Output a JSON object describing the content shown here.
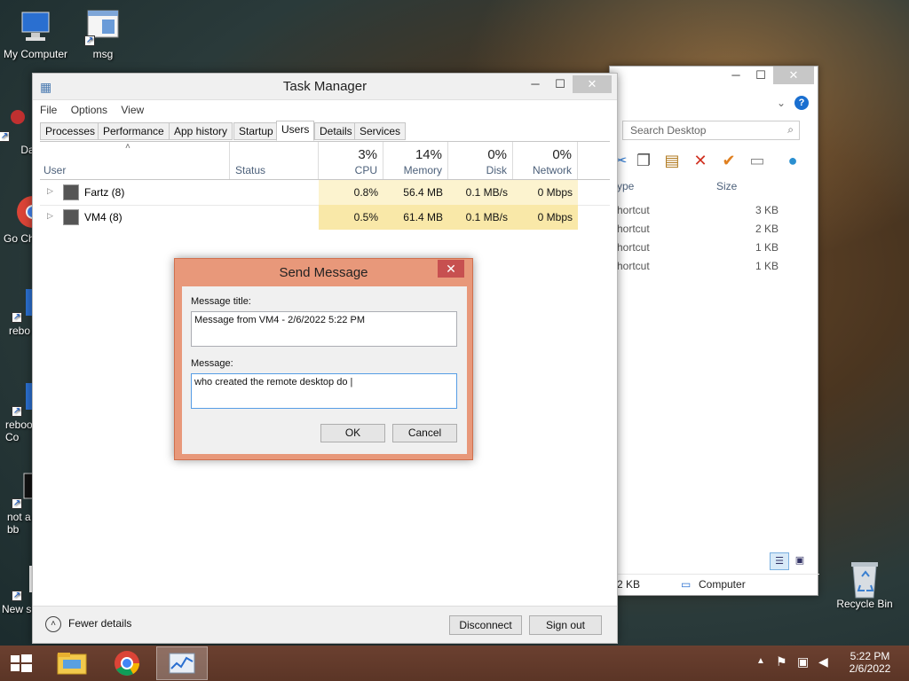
{
  "desktop": {
    "icons": [
      {
        "label": "My Computer"
      },
      {
        "label": "msg"
      },
      {
        "label": "DataW"
      },
      {
        "label": "Go Chr"
      },
      {
        "label": "rebo"
      },
      {
        "label": "reboo Co"
      },
      {
        "label": "not a bb"
      },
      {
        "label": "New s"
      },
      {
        "label": "Recycle Bin"
      }
    ]
  },
  "explorer": {
    "search_placeholder": "Search Desktop",
    "columns": {
      "type": "ype",
      "size": "Size"
    },
    "rows": [
      {
        "type": "hortcut",
        "size": "3 KB"
      },
      {
        "type": "hortcut",
        "size": "2 KB"
      },
      {
        "type": "hortcut",
        "size": "1 KB"
      },
      {
        "type": "hortcut",
        "size": "1 KB"
      }
    ],
    "status_size": "2 KB",
    "status_location": "Computer"
  },
  "taskmgr": {
    "title": "Task Manager",
    "menu": {
      "file": "File",
      "options": "Options",
      "view": "View"
    },
    "tabs": [
      "Processes",
      "Performance",
      "App history",
      "Startup",
      "Users",
      "Details",
      "Services"
    ],
    "active_tab": "Users",
    "columns": {
      "user": "User",
      "status": "Status",
      "cpu_pct": "3%",
      "cpu": "CPU",
      "mem_pct": "14%",
      "mem": "Memory",
      "disk_pct": "0%",
      "disk": "Disk",
      "net_pct": "0%",
      "net": "Network"
    },
    "users": [
      {
        "name": "Fartz (8)",
        "status": "",
        "cpu": "0.8%",
        "mem": "56.4 MB",
        "disk": "0.1 MB/s",
        "net": "0 Mbps"
      },
      {
        "name": "VM4 (8)",
        "status": "",
        "cpu": "0.5%",
        "mem": "61.4 MB",
        "disk": "0.1 MB/s",
        "net": "0 Mbps"
      }
    ],
    "fewer_details": "Fewer details",
    "disconnect": "Disconnect",
    "sign_out": "Sign out"
  },
  "dialog": {
    "title": "Send Message",
    "title_label": "Message title:",
    "title_value": "Message from VM4 - 2/6/2022 5:22 PM",
    "message_label": "Message:",
    "message_value": "who created the remote desktop do |",
    "ok": "OK",
    "cancel": "Cancel"
  },
  "taskbar": {
    "time": "5:22 PM",
    "date": "2/6/2022"
  },
  "colors": {
    "dialog_frame": "#e8987a",
    "taskbar": "#5b3526",
    "cpu_heat": "#fcf3cf",
    "mem_heat": "#f9e8a8"
  }
}
